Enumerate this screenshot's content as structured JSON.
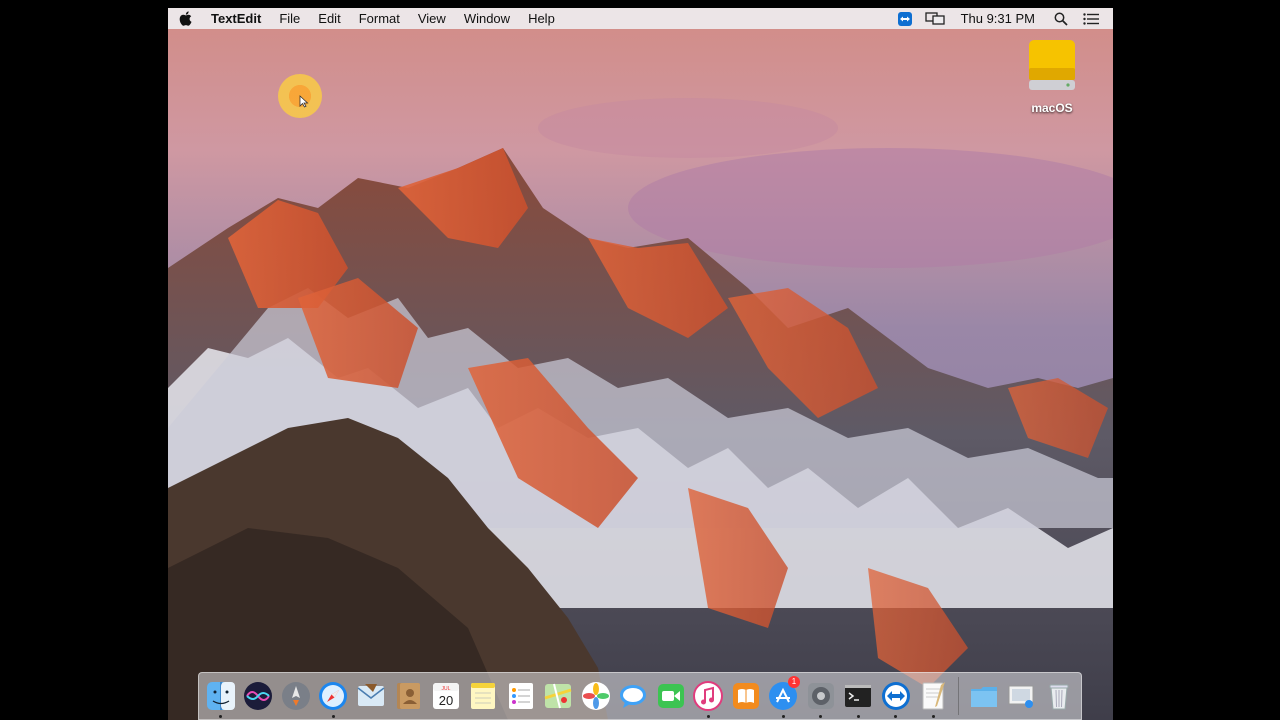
{
  "menubar": {
    "app_name": "TextEdit",
    "items": [
      "File",
      "Edit",
      "Format",
      "View",
      "Window",
      "Help"
    ],
    "clock": "Thu 9:31 PM",
    "status_icons": [
      "teamviewer-icon",
      "display-mirroring-icon",
      "spotlight-icon",
      "notification-center-icon"
    ]
  },
  "desktop": {
    "drive_label": "macOS",
    "wallpaper": "macOS Sierra mountain sunset"
  },
  "dock": {
    "apps": [
      {
        "name": "Finder",
        "icon": "finder-icon",
        "running": true
      },
      {
        "name": "Siri",
        "icon": "siri-icon",
        "running": false
      },
      {
        "name": "Launchpad",
        "icon": "launchpad-icon",
        "running": false
      },
      {
        "name": "Safari",
        "icon": "safari-icon",
        "running": true
      },
      {
        "name": "Mail",
        "icon": "mail-icon",
        "running": false
      },
      {
        "name": "Contacts",
        "icon": "contacts-icon",
        "running": false
      },
      {
        "name": "Calendar",
        "icon": "calendar-icon",
        "running": false,
        "month": "JUL",
        "day": "20"
      },
      {
        "name": "Notes",
        "icon": "notes-icon",
        "running": false
      },
      {
        "name": "Reminders",
        "icon": "reminders-icon",
        "running": false
      },
      {
        "name": "Maps",
        "icon": "maps-icon",
        "running": false
      },
      {
        "name": "Photos",
        "icon": "photos-icon",
        "running": false
      },
      {
        "name": "Messages",
        "icon": "messages-icon",
        "running": false
      },
      {
        "name": "FaceTime",
        "icon": "facetime-icon",
        "running": false
      },
      {
        "name": "iTunes",
        "icon": "itunes-icon",
        "running": true
      },
      {
        "name": "iBooks",
        "icon": "ibooks-icon",
        "running": false
      },
      {
        "name": "App Store",
        "icon": "app-store-icon",
        "running": true,
        "badge": "1"
      },
      {
        "name": "System Preferences",
        "icon": "system-preferences-icon",
        "running": true
      },
      {
        "name": "Terminal",
        "icon": "terminal-icon",
        "running": true
      },
      {
        "name": "TeamViewer",
        "icon": "teamviewer-icon",
        "running": true
      },
      {
        "name": "TextEdit",
        "icon": "textedit-icon",
        "running": true
      }
    ],
    "stacks": [
      {
        "name": "Downloads",
        "icon": "folder-icon"
      },
      {
        "name": "Screenshots",
        "icon": "stack-icon"
      },
      {
        "name": "Trash",
        "icon": "trash-icon"
      }
    ]
  },
  "colors": {
    "menubar_bg": "#eeecee",
    "drive_yellow": "#f5c400",
    "cursor_highlight": "#ffc83c"
  }
}
